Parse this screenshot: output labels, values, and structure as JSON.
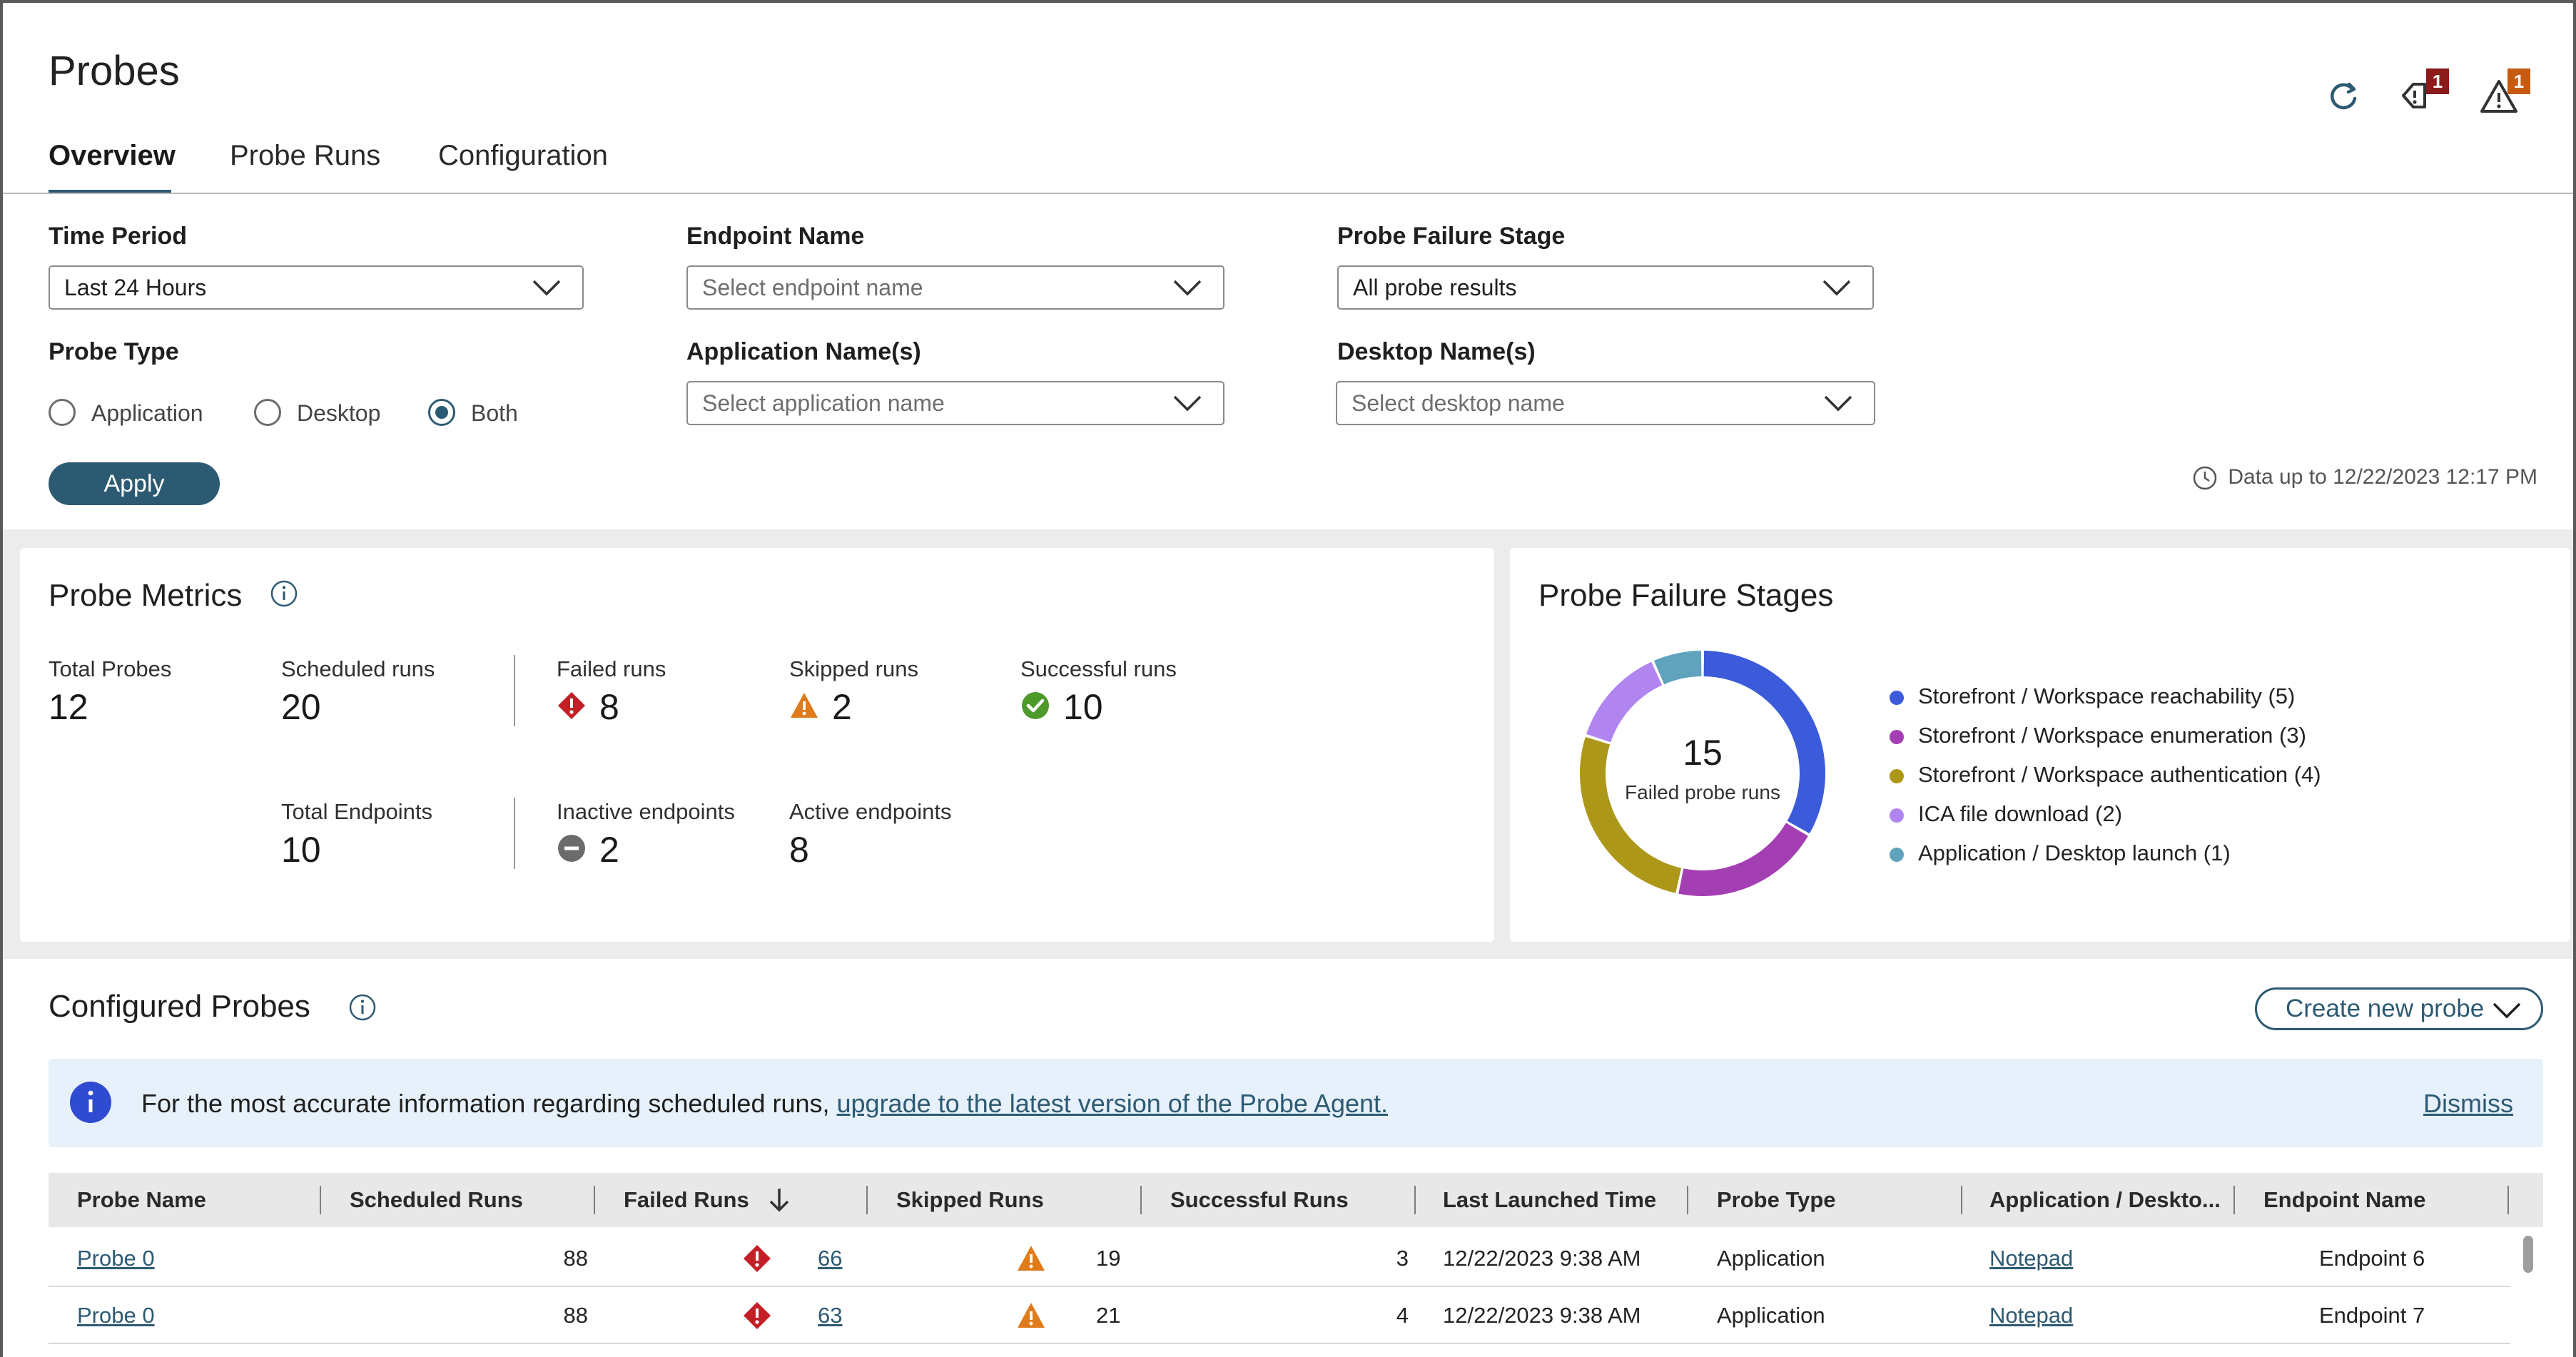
{
  "header": {
    "title": "Probes",
    "notification_badges": [
      {
        "icon": "alert-tag-icon",
        "count": "1",
        "color": "#8b1a1a"
      },
      {
        "icon": "warning-triangle-icon",
        "count": "1",
        "color": "#c65a11"
      }
    ]
  },
  "tabs": [
    "Overview",
    "Probe Runs",
    "Configuration"
  ],
  "filters": {
    "time_period": {
      "label": "Time Period",
      "value": "Last 24 Hours"
    },
    "endpoint_name": {
      "label": "Endpoint Name",
      "placeholder": "Select endpoint name"
    },
    "failure_stage": {
      "label": "Probe Failure Stage",
      "value": "All probe results"
    },
    "probe_type": {
      "label": "Probe Type",
      "options": [
        "Application",
        "Desktop",
        "Both"
      ],
      "selected": "Both"
    },
    "application_names": {
      "label": "Application Name(s)",
      "placeholder": "Select application name"
    },
    "desktop_names": {
      "label": "Desktop Name(s)",
      "placeholder": "Select desktop name"
    },
    "apply_label": "Apply",
    "data_upto": "Data up to 12/22/2023 12:17 PM"
  },
  "metrics": {
    "title": "Probe Metrics",
    "total_probes": {
      "label": "Total Probes",
      "value": "12"
    },
    "scheduled_runs": {
      "label": "Scheduled runs",
      "value": "20"
    },
    "failed_runs": {
      "label": "Failed runs",
      "value": "8"
    },
    "skipped_runs": {
      "label": "Skipped runs",
      "value": "2"
    },
    "successful_runs": {
      "label": "Successful runs",
      "value": "10"
    },
    "total_endpoints": {
      "label": "Total Endpoints",
      "value": "10"
    },
    "inactive_endpoints": {
      "label": "Inactive endpoints",
      "value": "2"
    },
    "active_endpoints": {
      "label": "Active endpoints",
      "value": "8"
    }
  },
  "failure_stages": {
    "title": "Probe Failure Stages",
    "center_value": "15",
    "center_label": "Failed probe runs"
  },
  "chart_data": {
    "type": "pie",
    "title": "Probe Failure Stages",
    "donut": true,
    "total": 15,
    "slices": [
      {
        "label": "Storefront / Workspace reachability (5)",
        "value": 5,
        "color": "#3b5bdb"
      },
      {
        "label": "Storefront / Workspace enumeration (3)",
        "value": 3,
        "color": "#a43fb3"
      },
      {
        "label": "Storefront / Workspace authentication (4)",
        "value": 4,
        "color": "#ad9719"
      },
      {
        "label": "ICA file download (2)",
        "value": 2,
        "color": "#b185f0"
      },
      {
        "label": "Application / Desktop launch (1)",
        "value": 1,
        "color": "#5fa3bd"
      }
    ]
  },
  "configured": {
    "title": "Configured Probes",
    "create_label": "Create new probe",
    "banner_text": "For the most accurate information regarding scheduled runs, ",
    "banner_link": "upgrade to the latest version of the Probe Agent.",
    "dismiss_label": "Dismiss",
    "columns": [
      "Probe Name",
      "Scheduled Runs",
      "Failed Runs",
      "Skipped Runs",
      "Successful Runs",
      "Last Launched Time",
      "Probe Type",
      "Application / Deskto...",
      "Endpoint Name"
    ],
    "rows": [
      {
        "name": "Probe 0",
        "scheduled": "88",
        "failed": "66",
        "skipped": "19",
        "successful": "3",
        "last_launched": "12/22/2023 9:38 AM",
        "type": "Application",
        "app": "Notepad",
        "endpoint": "Endpoint 6"
      },
      {
        "name": "Probe 0",
        "scheduled": "88",
        "failed": "63",
        "skipped": "21",
        "successful": "4",
        "last_launched": "12/22/2023 9:38 AM",
        "type": "Application",
        "app": "Notepad",
        "endpoint": "Endpoint 7"
      }
    ]
  }
}
